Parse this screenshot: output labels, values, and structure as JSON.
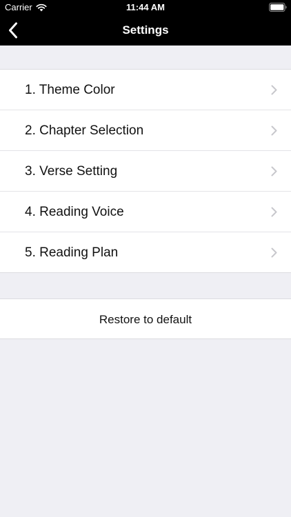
{
  "status_bar": {
    "carrier": "Carrier",
    "time": "11:44 AM",
    "wifi_icon": "wifi-icon",
    "battery_icon": "battery-icon"
  },
  "nav_bar": {
    "title": "Settings",
    "back_icon": "chevron-left-icon"
  },
  "menu": {
    "items": [
      {
        "label": "1. Theme Color"
      },
      {
        "label": "2. Chapter Selection"
      },
      {
        "label": "3. Verse Setting"
      },
      {
        "label": "4. Reading Voice"
      },
      {
        "label": "5. Reading Plan"
      }
    ],
    "disclosure_icon": "chevron-right-icon"
  },
  "restore": {
    "label": "Restore to default"
  },
  "colors": {
    "nav_background": "#000000",
    "page_background": "#efeff4",
    "cell_background": "#ffffff",
    "chevron": "#c7c7cc"
  }
}
